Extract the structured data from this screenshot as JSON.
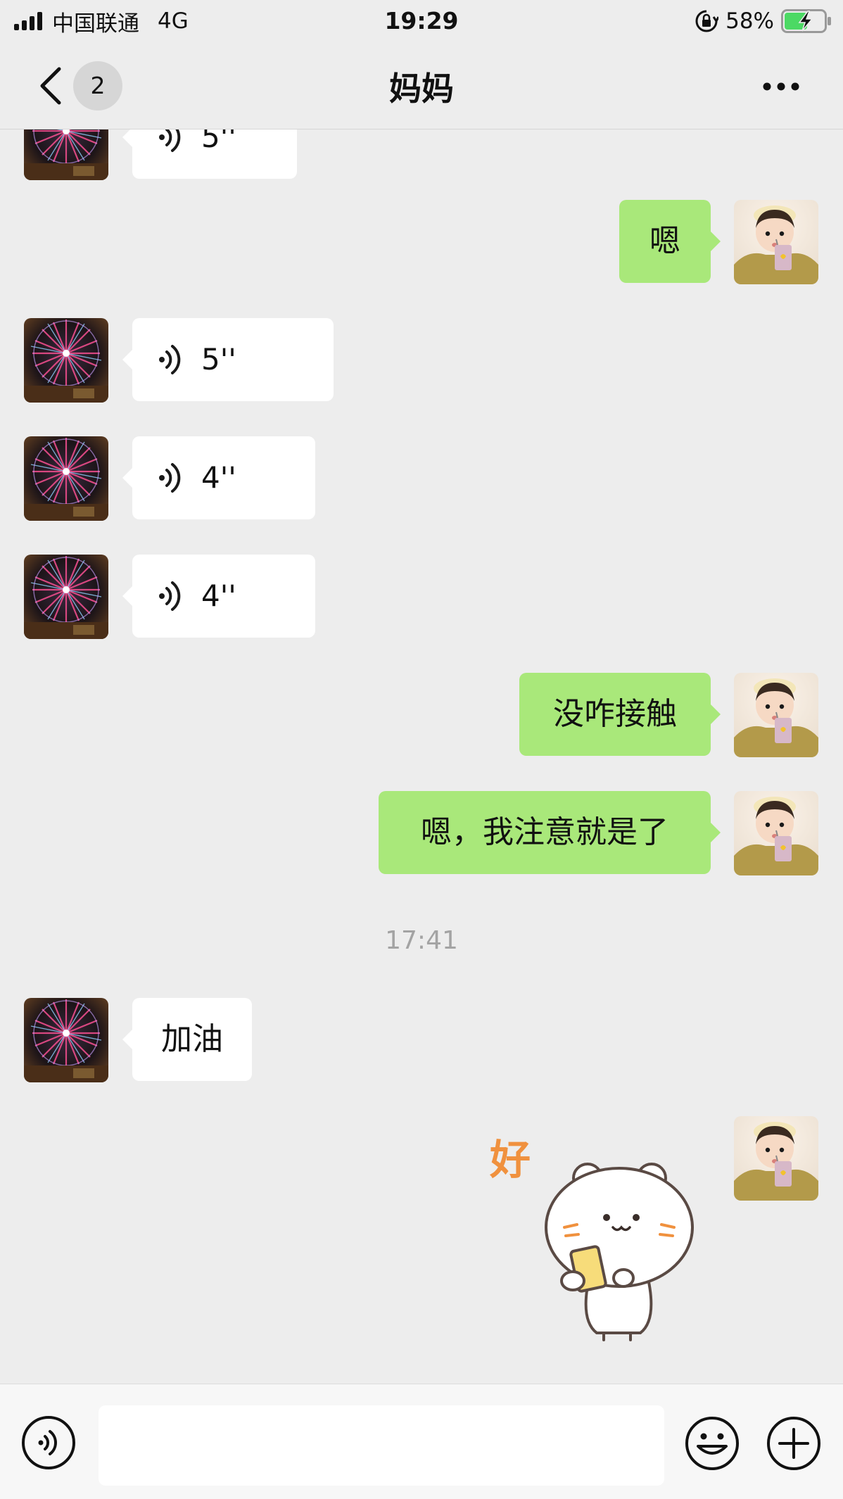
{
  "status_bar": {
    "carrier": "中国联通",
    "network": "4G",
    "time": "19:29",
    "battery": "58%",
    "battery_level": 0.58,
    "icons": [
      "signal-icon",
      "lock-rotation-icon",
      "battery-charging-icon"
    ]
  },
  "nav": {
    "unread_count": "2",
    "title": "妈妈",
    "icons": [
      "back-chevron-icon",
      "more-dots-icon"
    ]
  },
  "messages": [
    {
      "from": "contact",
      "type": "voice",
      "duration": "5''",
      "partial": true
    },
    {
      "from": "me",
      "type": "text",
      "text": "嗯"
    },
    {
      "from": "contact",
      "type": "voice",
      "duration": "5''"
    },
    {
      "from": "contact",
      "type": "voice",
      "duration": "4''"
    },
    {
      "from": "contact",
      "type": "voice",
      "duration": "4''"
    },
    {
      "from": "me",
      "type": "text",
      "text": "没咋接触"
    },
    {
      "from": "me",
      "type": "text",
      "text": "嗯，我注意就是了"
    },
    {
      "type": "timestamp",
      "text": "17:41"
    },
    {
      "from": "contact",
      "type": "text",
      "text": "加油"
    },
    {
      "from": "me",
      "type": "sticker",
      "sticker_text": "好"
    }
  ],
  "input_bar": {
    "icons": [
      "voice-mode-icon",
      "emoji-icon",
      "plus-icon"
    ]
  },
  "colors": {
    "background": "#ededed",
    "outgoing_bubble": "#a9e87a",
    "incoming_bubble": "#ffffff",
    "timestamp": "#a3a3a3",
    "sticker_text": "#f0913e"
  }
}
